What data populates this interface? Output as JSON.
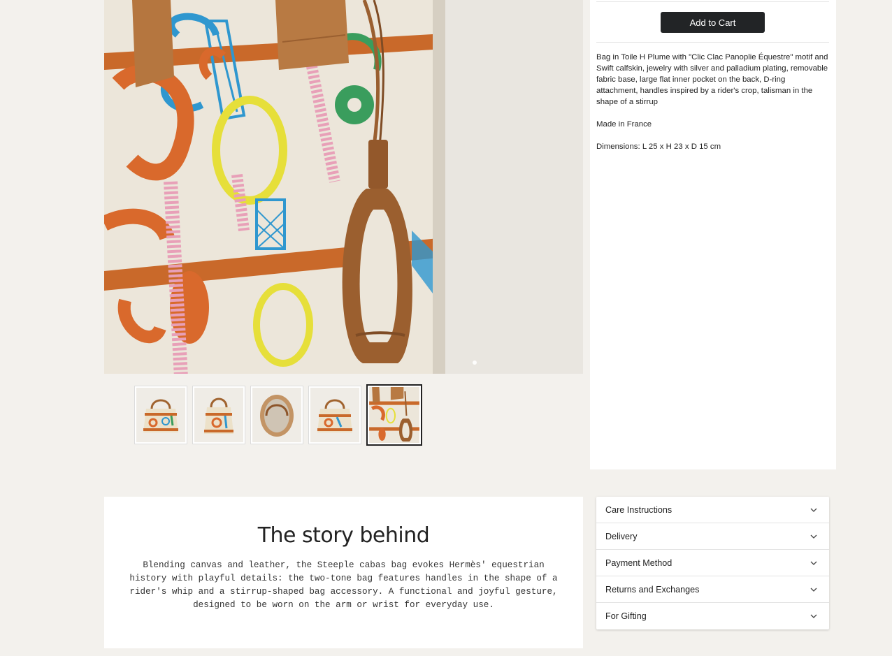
{
  "product": {
    "add_to_cart_label": "Add to Cart",
    "description": [
      "Bag in Toile H Plume with \"Clic Clac Panoplie Équestre\" motif and Swift calfskin, jewelry with silver and palladium plating, removable fabric base, large flat inner pocket on the back, D-ring attachment, handles inspired by a rider's crop, talisman in the shape of a stirrup",
      "Made in France",
      "Dimensions: L 25 x H 23 x D 15 cm"
    ]
  },
  "gallery": {
    "thumbnail_count": 5,
    "selected_index": 4,
    "carousel_active_dot": 1
  },
  "story": {
    "title": "The story behind",
    "body": "Blending canvas and leather, the Steeple cabas bag evokes Hermès' equestrian history with playful details: the two-tone bag features handles in the shape of a rider's whip and a stirrup-shaped bag accessory. A functional and joyful gesture, designed to be worn on the arm or wrist for everyday use."
  },
  "accordion": [
    {
      "label": "Care Instructions",
      "icon": "chevron-down-icon"
    },
    {
      "label": "Delivery",
      "icon": "chevron-down-icon"
    },
    {
      "label": "Payment Method",
      "icon": "chevron-down-icon"
    },
    {
      "label": "Returns and Exchanges",
      "icon": "chevron-down-icon"
    },
    {
      "label": "For Gifting",
      "icon": "chevron-down-icon"
    }
  ],
  "colors": {
    "page_background": "#f3f1ed",
    "button_background": "#222426",
    "leather": "#a8683a",
    "canvas": "#ece6da"
  }
}
